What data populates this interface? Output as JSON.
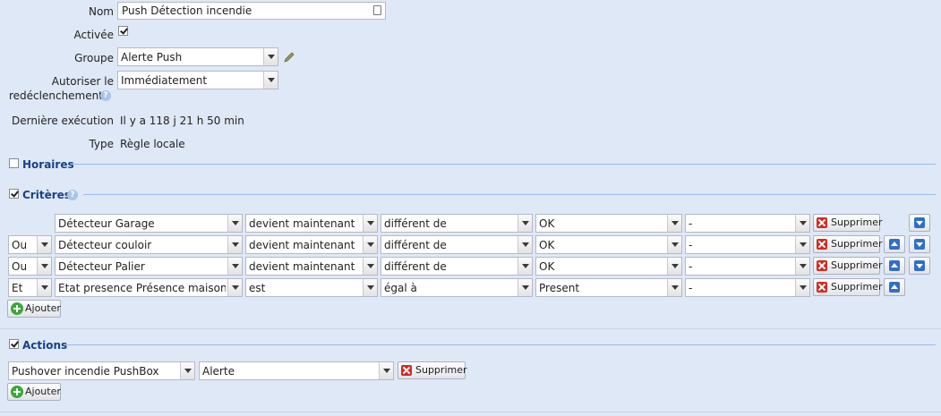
{
  "form": {
    "nom_label": "Nom",
    "nom_value": "Push Détection incendie",
    "activee_label": "Activée",
    "activee_checked": true,
    "groupe_label": "Groupe",
    "groupe_value": "Alerte Push",
    "autoriser_label_1": "Autoriser le",
    "autoriser_label_2": "redéclenchement",
    "autoriser_value": "Immédiatement",
    "derniere_label": "Dernière exécution",
    "derniere_value": "Il y a 118 j 21 h 50 min",
    "type_label": "Type",
    "type_value": "Règle locale"
  },
  "sections": {
    "horaires": "Horaires",
    "criteres": "Critères",
    "actions": "Actions"
  },
  "criteria": [
    {
      "op": "",
      "device": "Détecteur Garage",
      "verb": "devient maintenant",
      "cmp": "différent de",
      "value": "OK",
      "extra": "-",
      "delete": "Supprimer"
    },
    {
      "op": "Ou",
      "device": "Détecteur couloir",
      "verb": "devient maintenant",
      "cmp": "différent de",
      "value": "OK",
      "extra": "-",
      "delete": "Supprimer"
    },
    {
      "op": "Ou",
      "device": "Détecteur Palier",
      "verb": "devient maintenant",
      "cmp": "différent de",
      "value": "OK",
      "extra": "-",
      "delete": "Supprimer"
    },
    {
      "op": "Et",
      "device": "Etat presence Présence maison",
      "verb": "est",
      "cmp": "égal à",
      "value": "Present",
      "extra": "-",
      "delete": "Supprimer"
    }
  ],
  "add_label": "Ajouter",
  "actions_list": [
    {
      "target": "Pushover incendie PushBox",
      "message": "Alerte",
      "delete": "Supprimer"
    }
  ]
}
